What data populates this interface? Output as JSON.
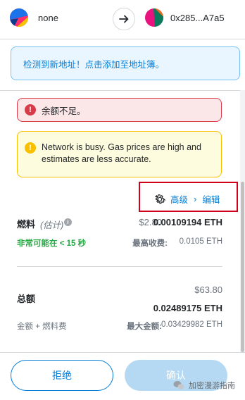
{
  "header": {
    "from_name": "none",
    "to_name": "0x285...A7a5"
  },
  "banner": {
    "new_address_text": "检测到新地址！点击添加至地址簿。"
  },
  "alerts": {
    "insufficient": "余额不足。",
    "busy": "Network is busy. Gas prices are high and estimates are less accurate."
  },
  "advanced": {
    "label": "高级",
    "edit": "编辑"
  },
  "gas": {
    "label": "燃料",
    "estimate": "(估计)",
    "fiat": "$2.80",
    "eth": "0.00109194 ETH",
    "likely": "非常可能在 < 15 秒",
    "max_fee_label": "最高收费:",
    "max_fee_value": "0.0105 ETH"
  },
  "total": {
    "label": "总额",
    "fiat": "$63.80",
    "eth": "0.02489175 ETH",
    "sub_label": "金额 + 燃料费",
    "max_amount_label": "最大金额:",
    "max_amount_value": "0.03429982 ETH"
  },
  "buttons": {
    "reject": "拒绝",
    "confirm": "确认"
  },
  "watermark": {
    "text": "加密漫游指南"
  },
  "colors": {
    "accent": "#037dd6",
    "error": "#d73a49",
    "warning": "#f8c000",
    "success": "#28a745",
    "highlight": "#d0021b"
  }
}
